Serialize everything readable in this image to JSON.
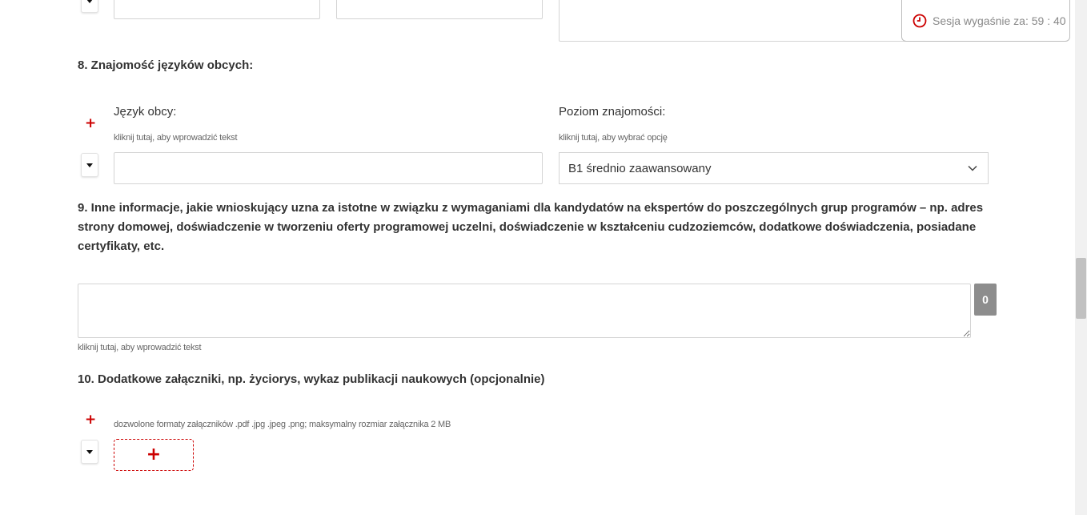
{
  "session": {
    "icon": "clock-icon",
    "label": "Sesja wygaśnie za:",
    "time": "59 : 40"
  },
  "section8": {
    "title": "8. Znajomość języków obcych:",
    "language_label": "Język obcy:",
    "language_hint": "kliknij tutaj, aby wprowadzić tekst",
    "language_value": "",
    "level_label": "Poziom znajomości:",
    "level_hint": "kliknij tutaj, aby wybrać opcję",
    "level_value": "B1 średnio zaawansowany"
  },
  "section9": {
    "title": "9. Inne informacje, jakie wnioskujący uzna za istotne w związku z wymaganiami dla kandydatów na ekspertów do poszczególnych grup programów  – np. adres strony domowej, doświadczenie w tworzeniu oferty programowej uczelni, doświadczenie w kształceniu cudzoziemców, dodatkowe doświadczenia, posiadane certyfikaty, etc.",
    "value": "",
    "counter": "0",
    "hint": "kliknij tutaj, aby wprowadzić tekst"
  },
  "section10": {
    "title": "10. Dodatkowe załączniki, np. życiorys, wykaz publikacji naukowych (opcjonalnie)",
    "hint": "dozwolone formaty załączników .pdf .jpg .jpeg .png; maksymalny rozmiar załącznika 2 MB"
  },
  "icons": {
    "plus": "+",
    "add": "+"
  },
  "colors": {
    "accent": "#cc0000",
    "counter_bg": "#8d8d8d",
    "border": "#d4d4d4"
  }
}
